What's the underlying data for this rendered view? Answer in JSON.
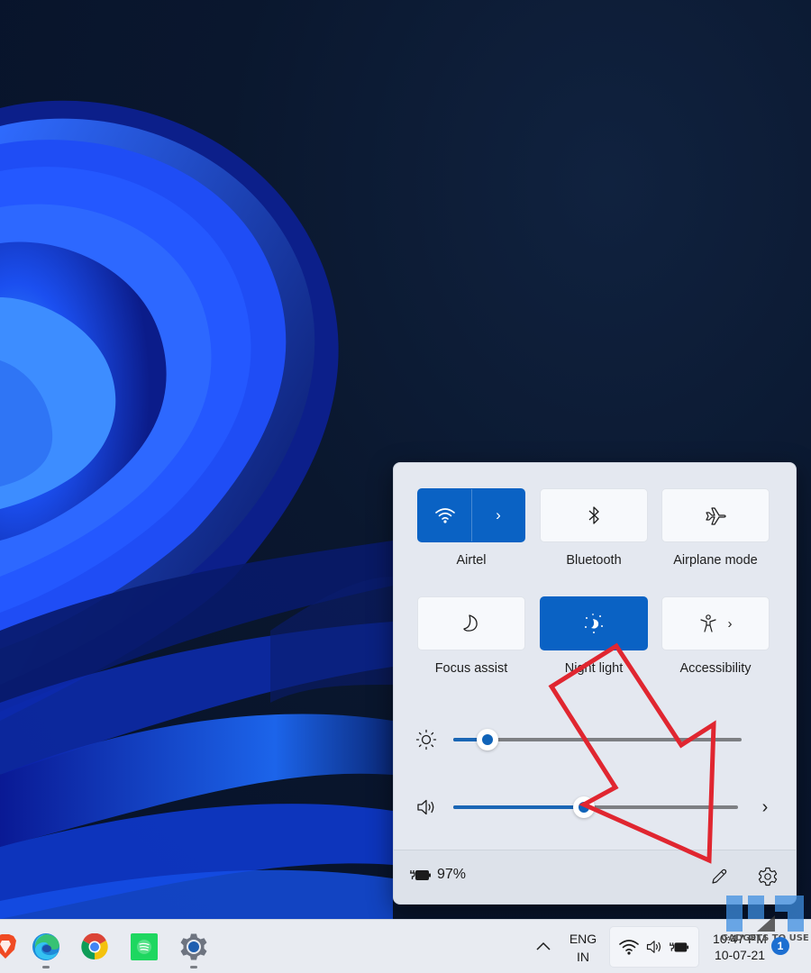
{
  "quick_settings": {
    "tiles": [
      {
        "id": "wifi",
        "label": "Airtel",
        "icon": "wifi-icon",
        "active": true,
        "has_arrow": true
      },
      {
        "id": "bluetooth",
        "label": "Bluetooth",
        "icon": "bluetooth-icon",
        "active": false,
        "has_arrow": false
      },
      {
        "id": "airplane",
        "label": "Airplane mode",
        "icon": "airplane-icon",
        "active": false,
        "has_arrow": false
      },
      {
        "id": "focus",
        "label": "Focus assist",
        "icon": "moon-icon",
        "active": false,
        "has_arrow": false
      },
      {
        "id": "nightlight",
        "label": "Night light",
        "icon": "night-light-icon",
        "active": true,
        "has_arrow": false
      },
      {
        "id": "accessibility",
        "label": "Accessibility",
        "icon": "accessibility-icon",
        "active": false,
        "has_arrow": true
      }
    ],
    "arrow_glyph": "›",
    "brightness": {
      "icon": "brightness-icon",
      "value_percent": 12
    },
    "volume": {
      "icon": "speaker-icon",
      "value_percent": 46,
      "more_glyph": "›"
    },
    "footer": {
      "battery_icon": "battery-charging-icon",
      "battery_percent": "97%",
      "edit_icon": "pencil-icon",
      "settings_icon": "gear-icon"
    }
  },
  "taskbar": {
    "apps": [
      {
        "name": "Brave",
        "icon": "brave-icon",
        "running": false
      },
      {
        "name": "Microsoft Edge",
        "icon": "edge-icon",
        "running": true
      },
      {
        "name": "Google Chrome",
        "icon": "chrome-icon",
        "running": false
      },
      {
        "name": "Spotify",
        "icon": "spotify-icon",
        "running": false
      },
      {
        "name": "Settings",
        "icon": "settings-icon",
        "running": true
      }
    ],
    "tray_chevron": "^",
    "language": {
      "line1": "ENG",
      "line2": "IN"
    },
    "tray_icons": [
      "wifi-icon",
      "speaker-icon",
      "battery-charging-icon"
    ],
    "clock": {
      "time": "10:47 PM",
      "date": "10-07-21"
    },
    "notification_count": "1"
  },
  "annotation": {
    "type": "arrow",
    "color": "#e02630",
    "points_to": "edit-quick-settings-button"
  },
  "watermark": {
    "text": "GADGETS TO USE"
  },
  "colors": {
    "accent": "#0a62c4",
    "panel_bg": "#e4e8f0",
    "taskbar_bg": "#e8ebf1"
  }
}
